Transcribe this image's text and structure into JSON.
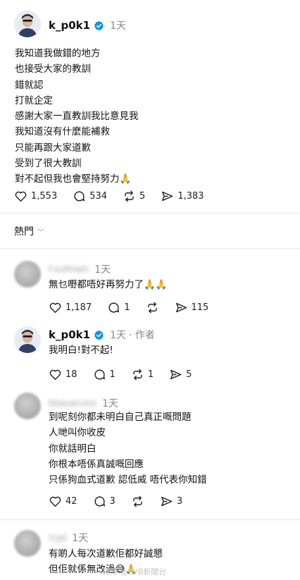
{
  "main_post": {
    "username": "k_p0k1",
    "time": "1天",
    "lines": [
      "我知道我做錯的地方",
      "也接受大家的教訓",
      "錯就認",
      "打就企定",
      "感謝大家一直教訓我比意見我",
      "我知道沒有什麼能補救",
      "只能再跟大家道歉",
      "受到了很大教訓",
      "對不起但我也會堅持努力🙏"
    ],
    "likes": "1,553",
    "replies": "534",
    "reposts": "5",
    "shares": "1,383"
  },
  "sort_label": "熱門",
  "comments": [
    {
      "username": "f·oufmaln",
      "time": "1天",
      "lines": [
        "無乜嘢都唔好再努力了🙏🙏"
      ],
      "likes": "1,187",
      "replies": "1",
      "reposts": "",
      "shares": "115"
    },
    {
      "username": "k_p0k1",
      "time": "1天",
      "author_tag": "· 作者",
      "lines": [
        "我明白!對不起!"
      ],
      "likes": "18",
      "replies": "1",
      "reposts": "1",
      "shares": "5"
    },
    {
      "username": "bbauarumz",
      "time": "1天",
      "lines": [
        "到呢刻你都未明白自己真正嘅問題",
        "人哋叫你收皮",
        "你就話明白",
        "你根本唔係真誠嘅回應",
        "只係狗血式道歉 認低威 唔代表你知錯"
      ],
      "likes": "42",
      "replies": "3",
      "reposts": "",
      "shares": "3"
    },
    {
      "username": "rcjal",
      "time": "1天",
      "lines": [
        "有啲人每次道歉佢都好誠懇",
        "但佢就係無改過😅🙏"
      ]
    }
  ],
  "watermark": "微博 @TVB新聞台",
  "colors": {
    "verified": "#0095f6",
    "muted": "#888888",
    "divider": "#e6e6e6"
  }
}
